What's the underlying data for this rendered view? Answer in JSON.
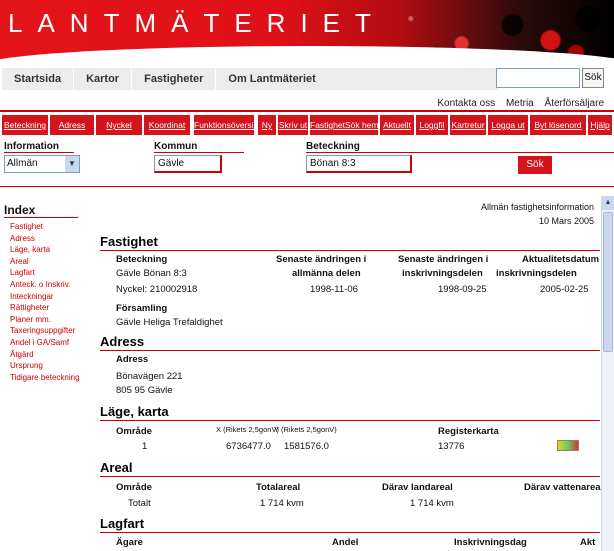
{
  "banner": {
    "title": "LANTMÄTERIET"
  },
  "topnav": {
    "items": [
      "Startsida",
      "Kartor",
      "Fastigheter",
      "Om Lantmäteriet"
    ],
    "search_button": "Sök",
    "links": [
      "Kontakta oss",
      "Metria",
      "Återförsäljare"
    ]
  },
  "toolbar": {
    "buttons": [
      "Beteckning",
      "Adress",
      "Nyckel",
      "Koordinat",
      "Funktionsöversikt",
      "Ny",
      "Skriv ut",
      "FastighetSök hem",
      "Aktuellt",
      "Loggfil",
      "Kartretur",
      "Logga ut",
      "Byt lösenord",
      "Hjälp"
    ]
  },
  "inforow": {
    "information_label": "Information",
    "information_value": "Allmän",
    "kommun_label": "Kommun",
    "kommun_value": "Gävle",
    "beteckning_label": "Beteckning",
    "beteckning_value": "Bönan 8:3",
    "search_button": "Sök"
  },
  "index": {
    "title": "Index",
    "items": [
      "Fastighet",
      "Adress",
      "Läge, karta",
      "Areal",
      "Lagfart",
      "Anteck. o Inskriv.",
      "Inteckningar",
      "Rättigheter",
      "Planer mm.",
      "Taxeringsuppgifter",
      "Andel i GA/Samf",
      "Åtgärd",
      "Ursprung",
      "Tidigare beteckning"
    ]
  },
  "main": {
    "doc_type": "Allmän fastighetsinformation",
    "doc_date": "10 Mars 2005",
    "fastighet": {
      "title": "Fastighet",
      "h_beteckning": "Beteckning",
      "h_senaste_allm_1": "Senaste ändringen i",
      "h_senaste_allm_2": "allmänna delen",
      "h_senaste_inskr_1": "Senaste ändringen i",
      "h_senaste_inskr_2": "inskrivningsdelen",
      "h_aktual_1": "Aktualitetsdatum i",
      "h_aktual_2": "inskrivningsdelen",
      "beteckning": "Gävle Bönan 8:3",
      "nyckel": "Nyckel: 210002918",
      "senaste_allm": "1998-11-06",
      "senaste_inskr": "1998-09-25",
      "aktual": "2005-02-25",
      "h_forsamling": "Församling",
      "forsamling": "Gävle Heliga Trefaldighet"
    },
    "adress": {
      "title": "Adress",
      "h_adress": "Adress",
      "line1": "Bönavägen 221",
      "line2": "805 95 Gävle"
    },
    "lage": {
      "title": "Läge, karta",
      "h_omrade": "Område",
      "h_x": "X (Rikets 2,5gonV)",
      "h_y": "Y (Rikets 2,5gonV)",
      "h_registerkarta": "Registerkarta",
      "omrade": "1",
      "x": "6736477.0",
      "y": "1581576.0",
      "registerkarta": "13776"
    },
    "areal": {
      "title": "Areal",
      "h_omrade": "Område",
      "h_totalareal": "Totalareal",
      "h_landareal": "Därav landareal",
      "h_vattenareal": "Därav vattenareal",
      "omrade": "Totalt",
      "totalareal": "1 714 kvm",
      "landareal": "1 714 kvm"
    },
    "lagfart": {
      "title": "Lagfart",
      "h_agare": "Ägare",
      "h_andel": "Andel",
      "h_inskrivningsdag": "Inskrivningsdag",
      "h_akt": "Akt"
    }
  }
}
